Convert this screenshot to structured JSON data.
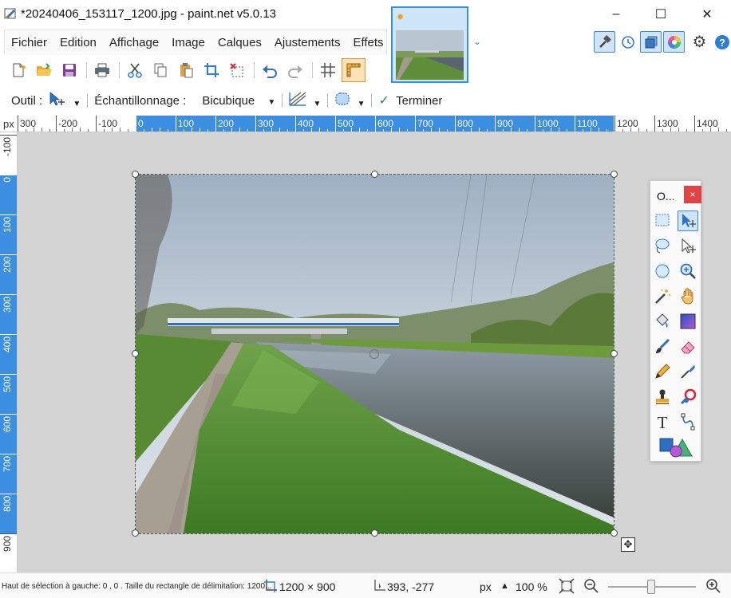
{
  "window": {
    "title": "*20240406_153117_1200.jpg - paint.net v5.0.13",
    "minimize": "–",
    "maximize": "☐",
    "close": "✕"
  },
  "menu": [
    "Fichier",
    "Edition",
    "Affichage",
    "Image",
    "Calques",
    "Ajustements",
    "Effets"
  ],
  "options": {
    "tool_label": "Outil :",
    "sampling_label": "Échantillonnage :",
    "sampling_value": "Bicubique",
    "finish_label": "Terminer"
  },
  "ruler": {
    "unit": "px",
    "h_labels": [
      "300",
      "-200",
      "-100",
      "0",
      "100",
      "200",
      "300",
      "400",
      "500",
      "600",
      "700",
      "800",
      "900",
      "1000",
      "1100",
      "1200",
      "1300",
      "1400"
    ],
    "v_labels": [
      "-100",
      "0",
      "100",
      "200",
      "300",
      "400",
      "500",
      "600",
      "700",
      "800",
      "900"
    ]
  },
  "tools_panel": {
    "title": "O...",
    "close": "×"
  },
  "status": {
    "hint": "Haut de sélection à gauche: 0 , 0 . Taille du rectangle de délimitation: 1200...",
    "size": "1200 × 900",
    "coords": "393, -277",
    "unit": "px",
    "zoom": "100 %"
  },
  "colors": {
    "accent": "#3d8fd9",
    "ruler_highlight": "#3b8ee0",
    "canvas_bg": "#d4d4d4"
  }
}
